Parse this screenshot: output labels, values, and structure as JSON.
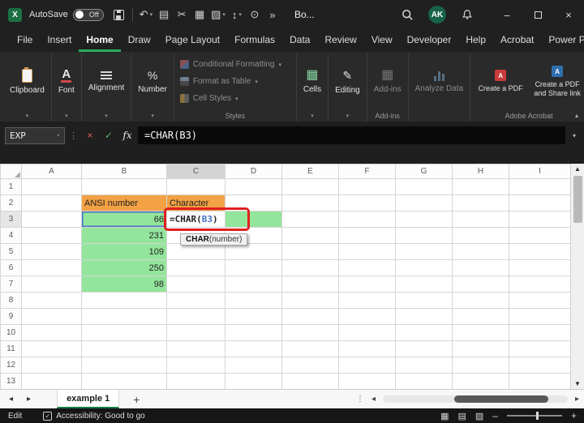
{
  "titlebar": {
    "autosave_label": "AutoSave",
    "autosave_state": "Off",
    "doc_title": "Bo...",
    "avatar_initials": "AK"
  },
  "menubar": {
    "items": [
      "File",
      "Insert",
      "Home",
      "Draw",
      "Page Layout",
      "Formulas",
      "Data",
      "Review",
      "View",
      "Developer",
      "Help",
      "Acrobat",
      "Power Pivot"
    ]
  },
  "ribbon": {
    "clipboard": "Clipboard",
    "font": "Font",
    "alignment": "Alignment",
    "number": "Number",
    "styles": {
      "items": [
        "Conditional Formatting",
        "Format as Table",
        "Cell Styles"
      ],
      "label": "Styles"
    },
    "cells": "Cells",
    "editing": "Editing",
    "addins": {
      "button": "Add-ins",
      "label": "Add-ins"
    },
    "analyze": "Analyze Data",
    "acrobat": {
      "buttons": [
        "Create a PDF",
        "Create a PDF and Share link"
      ],
      "label": "Adobe Acrobat"
    }
  },
  "formula_bar": {
    "name_box": "EXP",
    "fx": "fx",
    "formula": "=CHAR(B3)"
  },
  "grid": {
    "col_headers": [
      "A",
      "B",
      "C",
      "D",
      "E",
      "F",
      "G",
      "H",
      "I"
    ],
    "row_headers": [
      "1",
      "2",
      "3",
      "4",
      "5",
      "6",
      "7",
      "8",
      "9",
      "10",
      "11",
      "12",
      "13"
    ],
    "b2": "ANSI number",
    "c2": "Character",
    "b_values": [
      "66",
      "231",
      "109",
      "250",
      "98"
    ],
    "edit": {
      "prefix": "=CHAR(",
      "ref": "B3",
      "suffix": ")"
    },
    "tooltip": {
      "fn": "CHAR",
      "args": "(number)"
    }
  },
  "sheet_bar": {
    "tab": "example 1"
  },
  "status_bar": {
    "mode": "Edit",
    "accessibility": "Accessibility: Good to go"
  },
  "colors": {
    "header_orange": "#F2A144",
    "cell_green": "#93E59C",
    "annotation_red": "#E0201E",
    "reference_blue": "#4472C4",
    "excel_green": "#21A366"
  }
}
